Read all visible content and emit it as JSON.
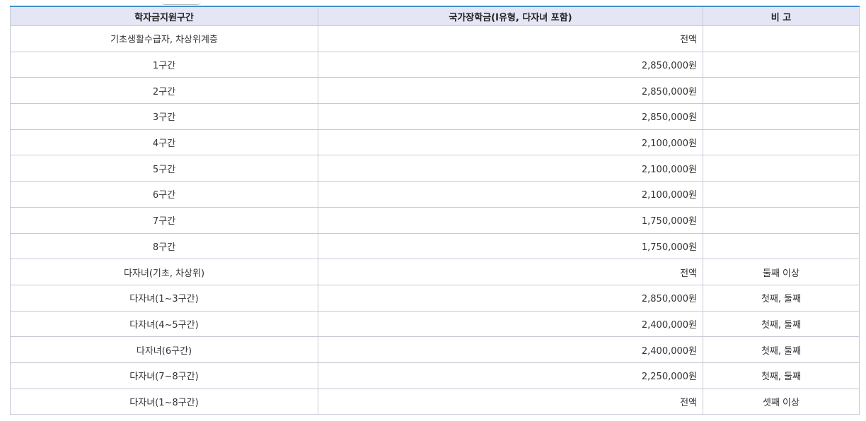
{
  "table": {
    "headers": [
      "학자금지원구간",
      "국가장학금(Ⅰ유형, 다자녀 포함)",
      "비 고"
    ],
    "rows": [
      {
        "section": "기초생활수급자, 차상위계층",
        "amount": "전액",
        "note": ""
      },
      {
        "section": "1구간",
        "amount": "2,850,000원",
        "note": ""
      },
      {
        "section": "2구간",
        "amount": "2,850,000원",
        "note": ""
      },
      {
        "section": "3구간",
        "amount": "2,850,000원",
        "note": ""
      },
      {
        "section": "4구간",
        "amount": "2,100,000원",
        "note": ""
      },
      {
        "section": "5구간",
        "amount": "2,100,000원",
        "note": ""
      },
      {
        "section": "6구간",
        "amount": "2,100,000원",
        "note": ""
      },
      {
        "section": "7구간",
        "amount": "1,750,000원",
        "note": ""
      },
      {
        "section": "8구간",
        "amount": "1,750,000원",
        "note": ""
      },
      {
        "section": "다자녀(기초, 차상위)",
        "amount": "전액",
        "note": "둘째 이상"
      },
      {
        "section": "다자녀(1~3구간)",
        "amount": "2,850,000원",
        "note": "첫째, 둘째"
      },
      {
        "section": "다자녀(4~5구간)",
        "amount": "2,400,000원",
        "note": "첫째, 둘째"
      },
      {
        "section": "다자녀(6구간)",
        "amount": "2,400,000원",
        "note": "첫째, 둘째"
      },
      {
        "section": "다자녀(7~8구간)",
        "amount": "2,250,000원",
        "note": "첫째, 둘째"
      },
      {
        "section": "다자녀(1~8구간)",
        "amount": "전액",
        "note": "셋째 이상"
      }
    ]
  },
  "colors": {
    "accent_border": "#3f8fd1",
    "header_bg": "#e4e6f5",
    "grid": "#c7c9d6"
  }
}
